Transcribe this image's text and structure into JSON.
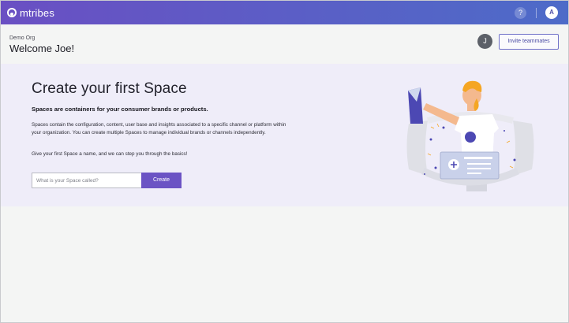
{
  "topbar": {
    "brand_name": "mtribes",
    "logo_icon": "mtribes-logo-icon",
    "help_label": "?",
    "user_initial": "A"
  },
  "header": {
    "org_name": "Demo Org",
    "welcome": "Welcome Joe!",
    "team_avatar_initial": "J",
    "invite_label": "Invite teammates"
  },
  "hero": {
    "title": "Create your first Space",
    "subtitle": "Spaces are containers for your consumer brands or products.",
    "description": "Spaces contain the configuration, content, user base and insights associated to a specific channel or platform within your organization. You can create multiple Spaces to manage individual brands or channels independently.",
    "hint": "Give your first Space a name, and we can step you through the basics!",
    "input_placeholder": "What is your Space called?",
    "input_value": "",
    "create_label": "Create"
  },
  "colors": {
    "accent": "#6b53c4",
    "topbar_start": "#6a4fc3",
    "topbar_end": "#4d6bc8",
    "hero_bg": "#efedf9",
    "page_bg": "#f4f5f4"
  }
}
